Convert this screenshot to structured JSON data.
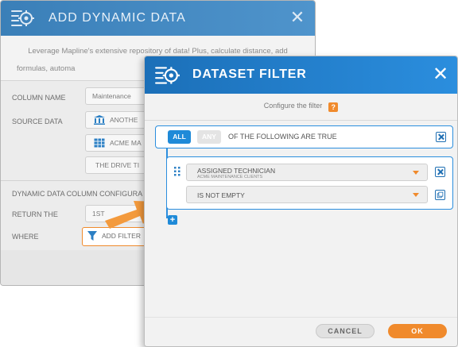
{
  "background_dialog": {
    "title": "ADD DYNAMIC DATA",
    "close_glyph": "✕",
    "description_line1": "Leverage Mapline's extensive repository of data! Plus, calculate distance, add",
    "description_line2": "formulas, automa",
    "column_name_label": "COLUMN NAME",
    "column_name_value": "Maintenance",
    "source_data_label": "SOURCE DATA",
    "source_option_1": "ANOTHE",
    "source_option_2": "ACME MA",
    "source_option_3": "THE DRIVE TI",
    "config_section_label": "DYNAMIC DATA COLUMN CONFIGURA",
    "return_the_label": "RETURN THE",
    "return_the_value": "1ST",
    "where_label": "WHERE",
    "add_filter_label": "ADD FILTER"
  },
  "dialog": {
    "title": "DATASET FILTER",
    "close_glyph": "✕",
    "subtitle": "Configure the filter",
    "help_glyph": "?",
    "group": {
      "all_label": "ALL",
      "any_label": "ANY",
      "selected": "ALL",
      "label": "OF THE FOLLOWING ARE TRUE"
    },
    "condition": {
      "field": "ASSIGNED TECHNICIAN",
      "field_source": "ACME MAINTENANCE CLIENTS",
      "operator": "IS NOT EMPTY"
    },
    "add_condition_glyph": "+",
    "cancel_label": "CANCEL",
    "ok_label": "OK"
  },
  "colors": {
    "header_blue": "#2b8ede",
    "accent_orange": "#f08a2c",
    "border_blue": "#2b8ede"
  },
  "icons": {
    "dialog_header": "database-settings-icon",
    "arrow": "orange-arrow-icon",
    "filter": "filter-funnel-icon",
    "bank": "bank-icon",
    "table": "table-icon"
  }
}
